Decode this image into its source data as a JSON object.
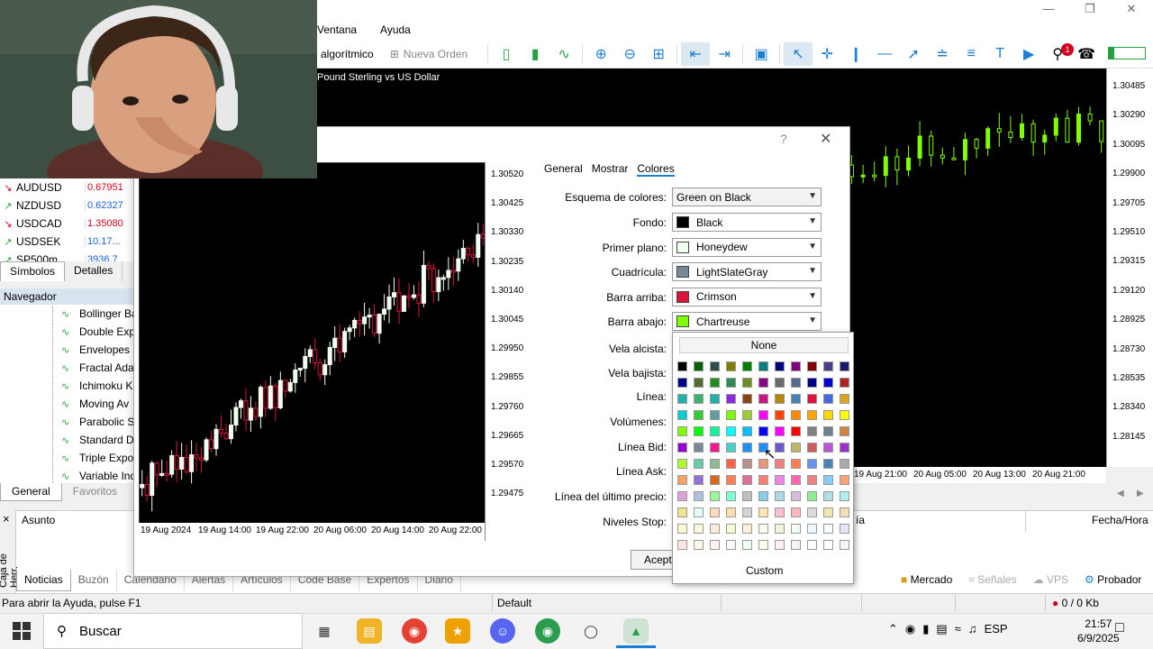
{
  "menu": [
    "Ventana",
    "Ayuda"
  ],
  "toolbar": {
    "algo": "g algorítmico",
    "new_order": "Nueva Orden",
    "notification_count": "1"
  },
  "main_chart": {
    "title": "Pound Sterling vs US Dollar",
    "price_labels": [
      "1.30485",
      "1.30290",
      "1.30095",
      "1.29900",
      "1.29705",
      "1.29510",
      "1.29315",
      "1.29120",
      "1.28925",
      "1.28730",
      "1.28535",
      "1.28340",
      "1.28145"
    ],
    "time_labels": [
      "19 Aug 21:00",
      "20 Aug 05:00",
      "20 Aug 13:00",
      "20 Aug 21:00"
    ]
  },
  "market_watch": {
    "rows": [
      {
        "symbol": "AUDUSD",
        "price": "0.67951",
        "dir": "down"
      },
      {
        "symbol": "NZDUSD",
        "price": "0.62327",
        "dir": "up"
      },
      {
        "symbol": "USDCAD",
        "price": "1.35080",
        "dir": "down"
      },
      {
        "symbol": "USDSEK",
        "price": "10.17...",
        "dir": "up"
      },
      {
        "symbol": "SP500m",
        "price": "3936.7",
        "dir": "up"
      }
    ],
    "tabs": [
      "Símbolos",
      "Detalles"
    ]
  },
  "navigator": {
    "title": "Navegador",
    "items": [
      "Bollinger Ba",
      "Double Exp",
      "Envelopes",
      "Fractal Ada",
      "Ichimoku K",
      "Moving Av",
      "Parabolic S",
      "Standard D",
      "Triple Expo",
      "Variable Ind"
    ],
    "tabs": [
      "General",
      "Favoritos"
    ]
  },
  "dialog": {
    "tabs": [
      "General",
      "Mostrar",
      "Colores"
    ],
    "active_tab": "Colores",
    "scheme_label": "Esquema de colores:",
    "scheme_value": "Green on Black",
    "fields": [
      {
        "label": "Fondo:",
        "value": "Black",
        "color": "#000000"
      },
      {
        "label": "Primer plano:",
        "value": "Honeydew",
        "color": "#f0fff0"
      },
      {
        "label": "Cuadrícula:",
        "value": "LightSlateGray",
        "color": "#778899"
      },
      {
        "label": "Barra arriba:",
        "value": "Crimson",
        "color": "#dc143c"
      },
      {
        "label": "Barra abajo:",
        "value": "Chartreuse",
        "color": "#7fff00"
      }
    ],
    "other_labels": [
      "Vela alcista:",
      "Vela bajista:",
      "Línea:",
      "Volúmenes:",
      "Línea Bid:",
      "Línea Ask:",
      "Línea del último precio:",
      "Niveles Stop:"
    ],
    "accept": "Acepta",
    "preview_prices": [
      "1.30520",
      "1.30425",
      "1.30330",
      "1.30235",
      "1.30140",
      "1.30045",
      "1.29950",
      "1.29855",
      "1.29760",
      "1.29665",
      "1.29570",
      "1.29475"
    ],
    "preview_times": [
      "19 Aug 2024",
      "19 Aug 14:00",
      "19 Aug 22:00",
      "20 Aug 06:00",
      "20 Aug 14:00",
      "20 Aug 22:00"
    ]
  },
  "palette": {
    "none_label": "None",
    "custom_label": "Custom",
    "colors": [
      [
        "#000000",
        "#006400",
        "#2f4f4f",
        "#808000",
        "#008000",
        "#008080",
        "#000080",
        "#800080",
        "#800000",
        "#483d8b",
        "#191970"
      ],
      [
        "#00008b",
        "#556b2f",
        "#228b22",
        "#2e8b57",
        "#6b8e23",
        "#8b008b",
        "#696969",
        "#556b8b",
        "#00008b",
        "#0000cd",
        "#b22222"
      ],
      [
        "#20b2aa",
        "#3cb371",
        "#20b2aa",
        "#8a2be2",
        "#8b4513",
        "#c71585",
        "#b8860b",
        "#4682b4",
        "#dc143c",
        "#4169e1",
        "#daa520"
      ],
      [
        "#00ced1",
        "#32cd32",
        "#5f9ea0",
        "#7cfc00",
        "#9acd32",
        "#ff00ff",
        "#ff4500",
        "#ff8c00",
        "#ffa500",
        "#ffd700",
        "#ffff00"
      ],
      [
        "#7fff00",
        "#00ff00",
        "#00fa9a",
        "#00ffff",
        "#00bfff",
        "#0000ff",
        "#ff00ff",
        "#ff0000",
        "#808080",
        "#708090",
        "#cd853f"
      ],
      [
        "#9400d3",
        "#778899",
        "#ff1493",
        "#48d1cc",
        "#1e90ff",
        "#1e90ff",
        "#6a5acd",
        "#bdb76b",
        "#cd5c5c",
        "#ba55d3",
        "#9932cc"
      ],
      [
        "#adff2f",
        "#66cdaa",
        "#8fbc8f",
        "#ff6347",
        "#bc8f8f",
        "#e9967a",
        "#f08080",
        "#ff7f50",
        "#6495ed",
        "#4682b4",
        "#a9a9a9"
      ],
      [
        "#f4a460",
        "#9370db",
        "#d2691e",
        "#ff7f50",
        "#db7093",
        "#fa8072",
        "#ee82ee",
        "#ff69b4",
        "#f08080",
        "#87cefa",
        "#ffa07a"
      ],
      [
        "#dda0dd",
        "#b0c4de",
        "#98fb98",
        "#7fffd4",
        "#c0c0c0",
        "#87ceeb",
        "#add8e6",
        "#d8bfd8",
        "#90ee90",
        "#b0e0e6",
        "#afeeee"
      ],
      [
        "#f0e68c",
        "#e0ffff",
        "#ffdab9",
        "#ffdead",
        "#d3d3d3",
        "#ffe4b5",
        "#ffc0cb",
        "#ffb6c1",
        "#dcdcdc",
        "#eee8aa",
        "#f5deb3"
      ],
      [
        "#fffacd",
        "#fff8dc",
        "#faebd7",
        "#fafad2",
        "#ffefd5",
        "#fffaf0",
        "#f5f5dc",
        "#f0fff0",
        "#f0f8ff",
        "#f5fffa",
        "#e6e6fa"
      ],
      [
        "#ffe4e1",
        "#fdf5e6",
        "#fff5ee",
        "#f8f8ff",
        "#f0fff0",
        "#fffff0",
        "#fff0f5",
        "#f5f5f5",
        "#fffafa",
        "#ffffff",
        "#f5f5f5"
      ]
    ]
  },
  "toolbox": {
    "close": "×",
    "side_label": "Caja de Herr.",
    "col_subject": "Asunto",
    "col_date": "Fecha/Hora",
    "col_mid": "ía",
    "tabs": [
      "Noticias",
      "Buzón",
      "Calendario",
      "Alertas",
      "Artículos",
      "Code Base",
      "Expertos",
      "Diario"
    ],
    "right_buttons": [
      "Mercado",
      "Señales",
      "VPS",
      "Probador"
    ]
  },
  "status": {
    "help": "Para abrir la Ayuda, pulse F1",
    "profile": "Default",
    "traffic": "0 / 0 Kb"
  },
  "taskbar": {
    "search": "Buscar",
    "lang": "ESP",
    "time": "21:57",
    "date": "6/9/2025"
  }
}
